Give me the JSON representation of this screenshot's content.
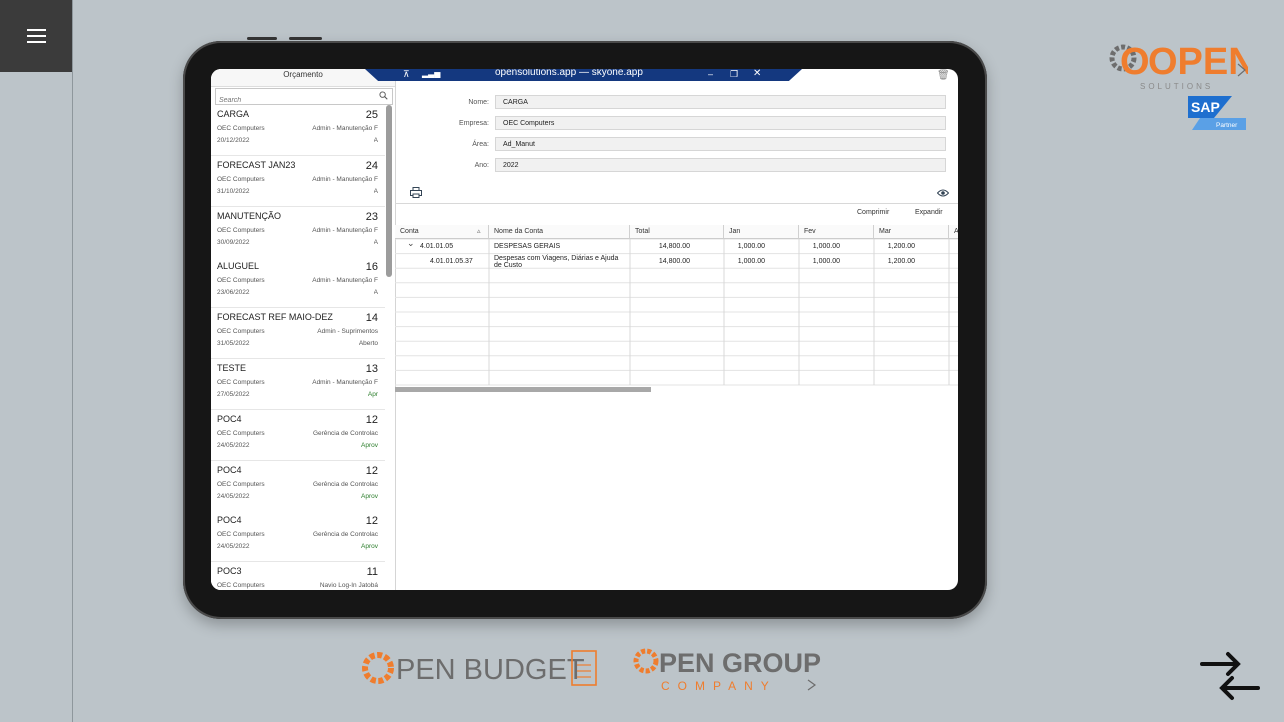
{
  "app": {
    "list_title": "Orçamento",
    "host": "opensolutions.app — skyone.app",
    "search_placeholder": "Search"
  },
  "list": [
    {
      "title": "CARGA",
      "num": "25",
      "company": "OEC Computers",
      "area": "Admin - Manutenção F",
      "date": "20/12/2022",
      "status": "A",
      "status_ok": false
    },
    {
      "title": "FORECAST JAN23",
      "num": "24",
      "company": "OEC Computers",
      "area": "Admin - Manutenção F",
      "date": "31/10/2022",
      "status": "A",
      "status_ok": false
    },
    {
      "title": "MANUTENÇÃO",
      "num": "23",
      "company": "OEC Computers",
      "area": "Admin - Manutenção F",
      "date": "30/09/2022",
      "status": "A",
      "status_ok": false
    },
    {
      "title": "ALUGUEL",
      "num": "16",
      "company": "OEC Computers",
      "area": "Admin - Manutenção F",
      "date": "23/06/2022",
      "status": "A",
      "status_ok": false
    },
    {
      "title": "FORECAST REF MAIO-DEZ",
      "num": "14",
      "company": "OEC Computers",
      "area": "Admin - Suprimentos",
      "date": "31/05/2022",
      "status": "Aberto",
      "status_ok": false
    },
    {
      "title": "TESTE",
      "num": "13",
      "company": "OEC Computers",
      "area": "Admin - Manutenção F",
      "date": "27/05/2022",
      "status": "Apr",
      "status_ok": true
    },
    {
      "title": "POC4",
      "num": "12",
      "company": "OEC Computers",
      "area": "Gerência de Controlac",
      "date": "24/05/2022",
      "status": "Aprov",
      "status_ok": true
    },
    {
      "title": "POC4",
      "num": "12",
      "company": "OEC Computers",
      "area": "Gerência de Controlac",
      "date": "24/05/2022",
      "status": "Aprov",
      "status_ok": true
    },
    {
      "title": "POC4",
      "num": "12",
      "company": "OEC Computers",
      "area": "Gerência de Controlac",
      "date": "24/05/2022",
      "status": "Aprov",
      "status_ok": true
    },
    {
      "title": "POC3",
      "num": "11",
      "company": "OEC Computers",
      "area": "Navio Log-In Jatobá",
      "date": "",
      "status": "",
      "status_ok": false
    }
  ],
  "form": {
    "nome_label": "Nome:",
    "nome_value": "CARGA",
    "empresa_label": "Empresa:",
    "empresa_value": "OEC Computers",
    "area_label": "Área:",
    "area_value": "Ad_Manut",
    "ano_label": "Ano:",
    "ano_value": "2022"
  },
  "toolbar": {
    "comprimir": "Comprimir",
    "expandir": "Expandir"
  },
  "grid": {
    "headers": [
      "Conta",
      "Nome da Conta",
      "Total",
      "Jan",
      "Fev",
      "Mar",
      "A"
    ],
    "rows": [
      {
        "conta": "4.01.01.05",
        "nome": "DESPESAS GERAIS",
        "total": "14,800.00",
        "jan": "1,000.00",
        "fev": "1,000.00",
        "mar": "1,200.00",
        "expandable": true
      },
      {
        "conta": "4.01.01.05.37",
        "nome": "Despesas com Viagens, Diárias e Ajuda de Custo",
        "total": "14,800.00",
        "jan": "1,000.00",
        "fev": "1,000.00",
        "mar": "1,200.00",
        "expandable": false
      }
    ]
  },
  "branding": {
    "open_text": "OPEN",
    "solutions_text": "SOLUTIONS",
    "sap_text": "SAP",
    "partner_text": "Partner",
    "budget_prefix": "PEN BUDGET",
    "group_prefix": "PEN GROUP",
    "company_text": "COMPANY",
    "orange": "#ef7d2e",
    "gray": "#6d6d6d",
    "sap_blue": "#1e6fcf"
  }
}
